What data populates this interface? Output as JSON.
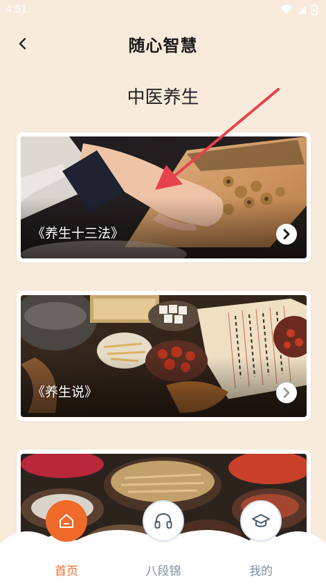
{
  "status_bar": {
    "time": "4:51"
  },
  "header": {
    "title": "随心智慧"
  },
  "section": {
    "title": "中医养生"
  },
  "cards": [
    {
      "label": "《养生十三法》"
    },
    {
      "label": "《养生说》"
    },
    {
      "label": ""
    }
  ],
  "tabbar": {
    "items": [
      {
        "label": "首页",
        "icon": "home-icon",
        "active": true
      },
      {
        "label": "八段锦",
        "icon": "headphones-icon",
        "active": false
      },
      {
        "label": "我的",
        "icon": "graduation-cap-icon",
        "active": false
      }
    ]
  },
  "colors": {
    "background": "#f8ebdc",
    "accent": "#f06a2a",
    "inactive_tab": "#7f8fa6",
    "annotation_arrow": "#e8414c"
  }
}
